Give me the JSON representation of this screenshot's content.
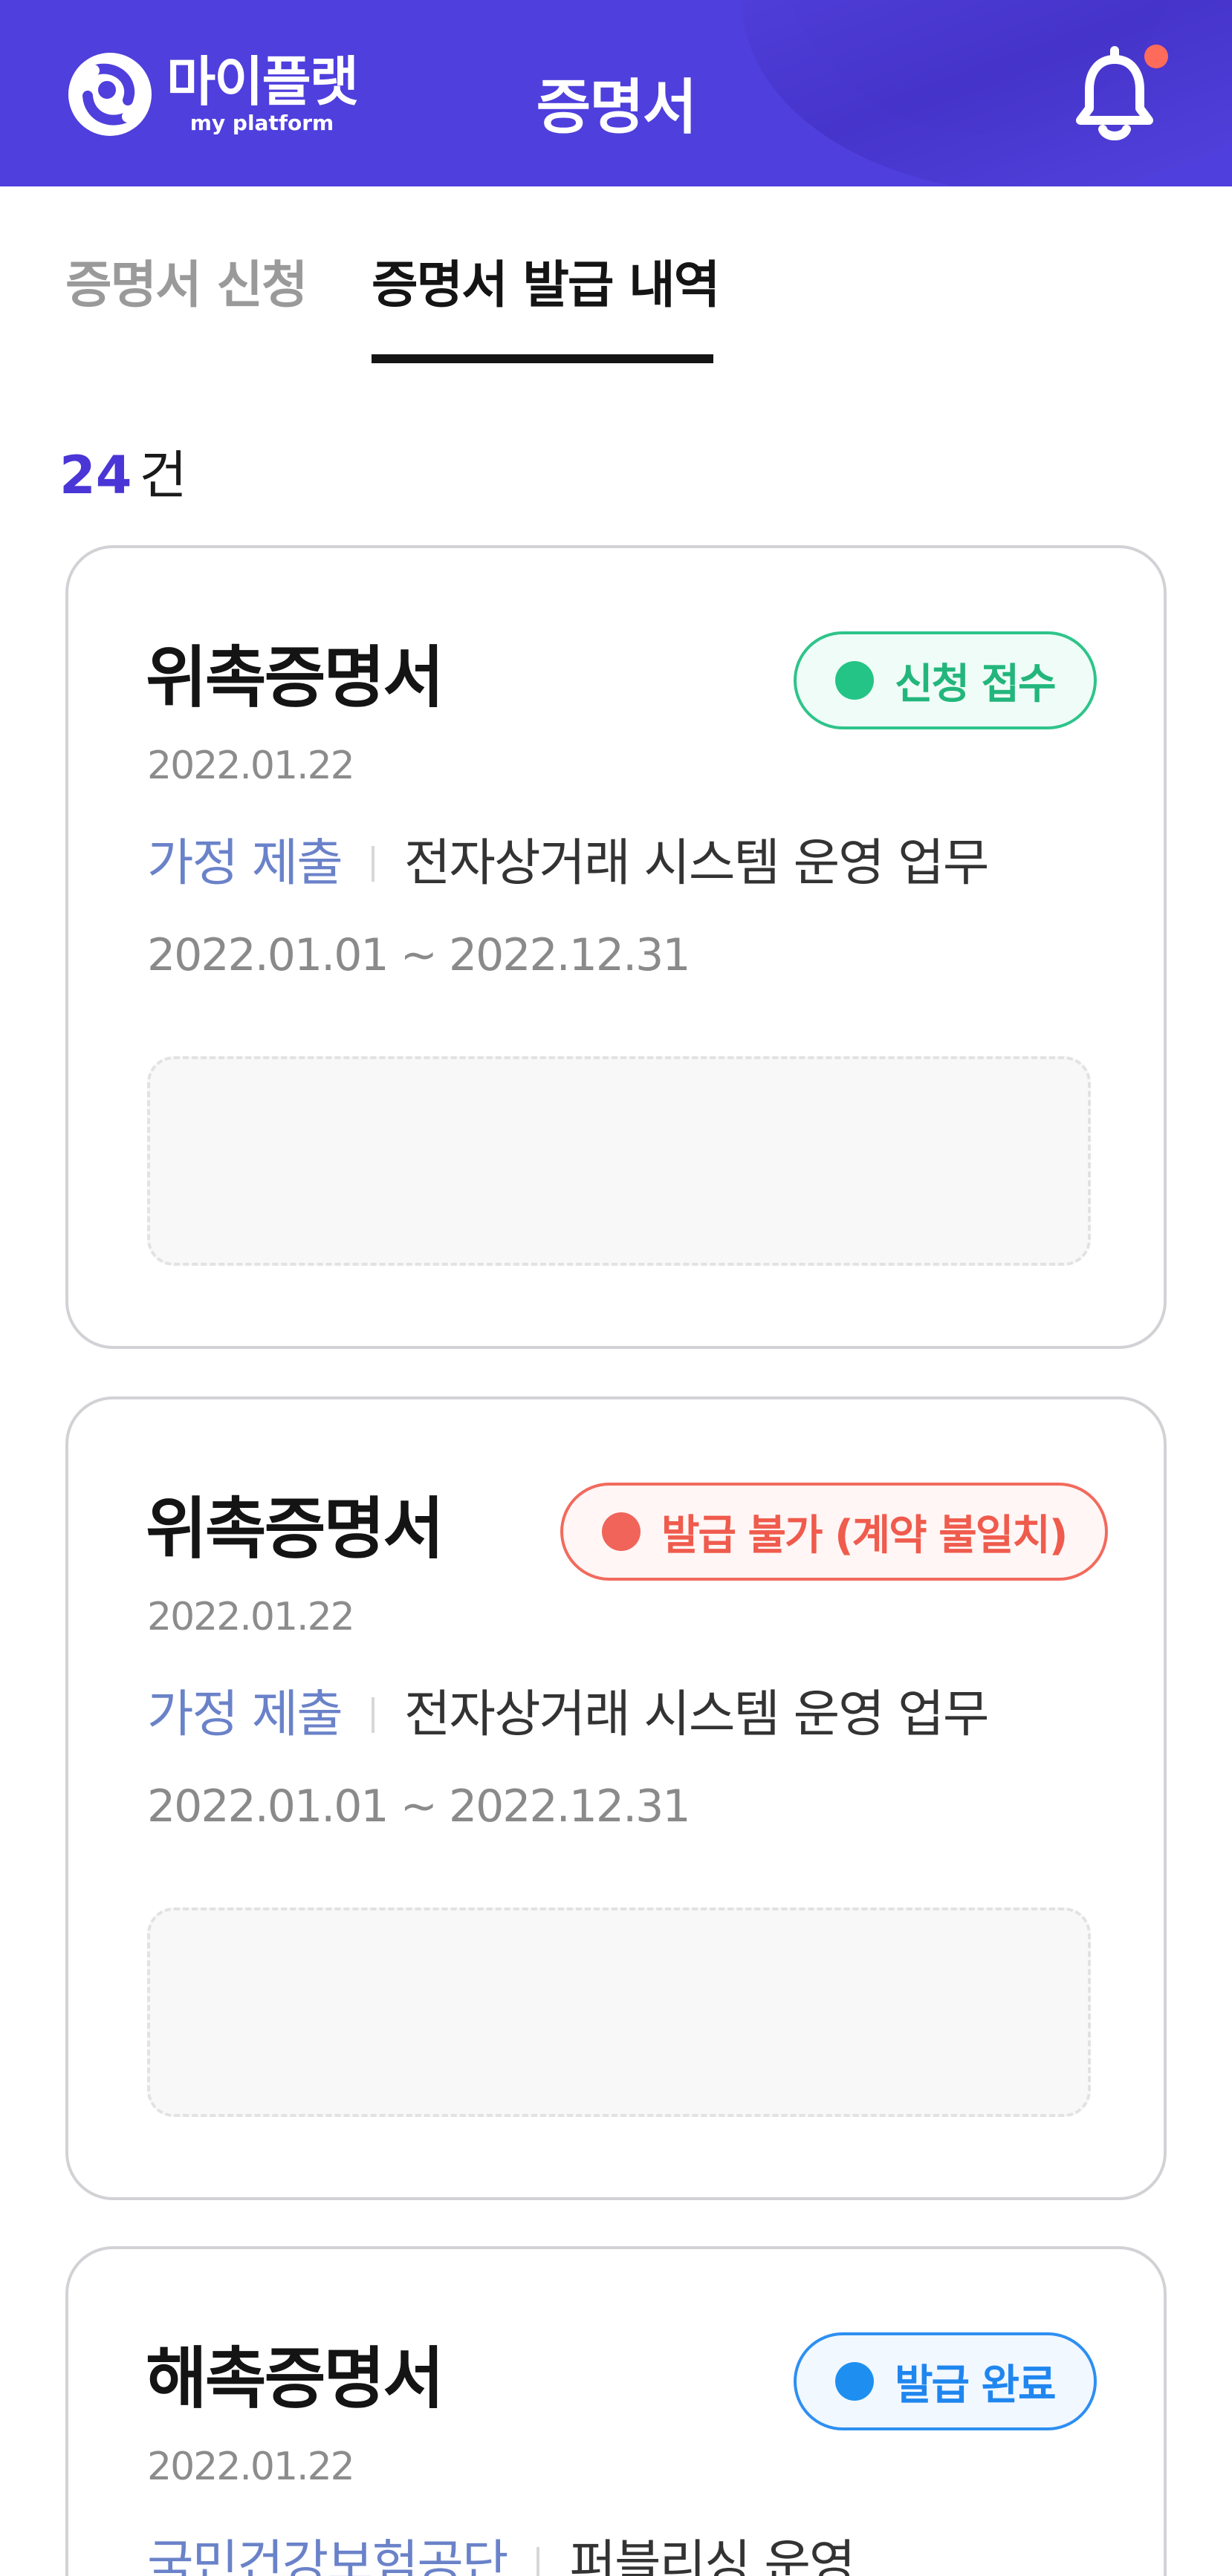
{
  "header": {
    "logo_text": "마이플랫",
    "logo_subtext": "my platform",
    "title": "증명서",
    "notification_icon": "bell-icon"
  },
  "tabs": [
    {
      "label": "증명서 신청",
      "active": false
    },
    {
      "label": "증명서 발급 내역",
      "active": true
    }
  ],
  "summary": {
    "count": "24",
    "unit": "건"
  },
  "cards": [
    {
      "title": "위촉증명서",
      "status": "신청 접수",
      "status_color": "#2ec48a",
      "date": "2022.01.22",
      "org": "가정 제출",
      "task": "전자상거래 시스템 운영 업무",
      "period": "2022.01.01 ~ 2022.12.31"
    },
    {
      "title": "위촉증명서",
      "status": "발급 불가 (계약 불일치)",
      "status_color": "#f26a5d",
      "date": "2022.01.22",
      "org": "가정 제출",
      "task": "전자상거래 시스템 운영 업무",
      "period": "2022.01.01 ~ 2022.12.31"
    },
    {
      "title": "해촉증명서",
      "status": "발급 완료",
      "status_color": "#2d8ff2",
      "date": "2022.01.22",
      "org": "국민건강보험공단",
      "task": "퍼블리싱 운영"
    }
  ],
  "colors": {
    "header_bg": "#4f3fdd",
    "accent": "#4a35d6"
  }
}
